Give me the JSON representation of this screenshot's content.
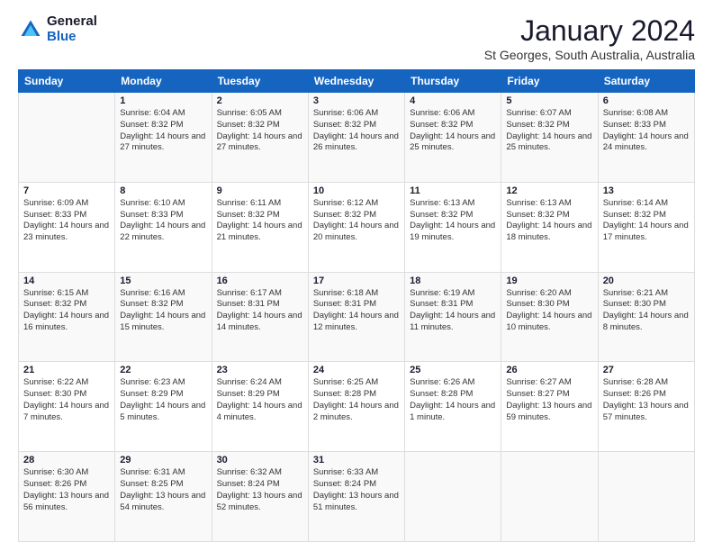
{
  "logo": {
    "general": "General",
    "blue": "Blue"
  },
  "header": {
    "title": "January 2024",
    "subtitle": "St Georges, South Australia, Australia"
  },
  "weekdays": [
    "Sunday",
    "Monday",
    "Tuesday",
    "Wednesday",
    "Thursday",
    "Friday",
    "Saturday"
  ],
  "weeks": [
    [
      {
        "day": "",
        "sunrise": "",
        "sunset": "",
        "daylight": ""
      },
      {
        "day": "1",
        "sunrise": "Sunrise: 6:04 AM",
        "sunset": "Sunset: 8:32 PM",
        "daylight": "Daylight: 14 hours and 27 minutes."
      },
      {
        "day": "2",
        "sunrise": "Sunrise: 6:05 AM",
        "sunset": "Sunset: 8:32 PM",
        "daylight": "Daylight: 14 hours and 27 minutes."
      },
      {
        "day": "3",
        "sunrise": "Sunrise: 6:06 AM",
        "sunset": "Sunset: 8:32 PM",
        "daylight": "Daylight: 14 hours and 26 minutes."
      },
      {
        "day": "4",
        "sunrise": "Sunrise: 6:06 AM",
        "sunset": "Sunset: 8:32 PM",
        "daylight": "Daylight: 14 hours and 25 minutes."
      },
      {
        "day": "5",
        "sunrise": "Sunrise: 6:07 AM",
        "sunset": "Sunset: 8:32 PM",
        "daylight": "Daylight: 14 hours and 25 minutes."
      },
      {
        "day": "6",
        "sunrise": "Sunrise: 6:08 AM",
        "sunset": "Sunset: 8:33 PM",
        "daylight": "Daylight: 14 hours and 24 minutes."
      }
    ],
    [
      {
        "day": "7",
        "sunrise": "Sunrise: 6:09 AM",
        "sunset": "Sunset: 8:33 PM",
        "daylight": "Daylight: 14 hours and 23 minutes."
      },
      {
        "day": "8",
        "sunrise": "Sunrise: 6:10 AM",
        "sunset": "Sunset: 8:33 PM",
        "daylight": "Daylight: 14 hours and 22 minutes."
      },
      {
        "day": "9",
        "sunrise": "Sunrise: 6:11 AM",
        "sunset": "Sunset: 8:32 PM",
        "daylight": "Daylight: 14 hours and 21 minutes."
      },
      {
        "day": "10",
        "sunrise": "Sunrise: 6:12 AM",
        "sunset": "Sunset: 8:32 PM",
        "daylight": "Daylight: 14 hours and 20 minutes."
      },
      {
        "day": "11",
        "sunrise": "Sunrise: 6:13 AM",
        "sunset": "Sunset: 8:32 PM",
        "daylight": "Daylight: 14 hours and 19 minutes."
      },
      {
        "day": "12",
        "sunrise": "Sunrise: 6:13 AM",
        "sunset": "Sunset: 8:32 PM",
        "daylight": "Daylight: 14 hours and 18 minutes."
      },
      {
        "day": "13",
        "sunrise": "Sunrise: 6:14 AM",
        "sunset": "Sunset: 8:32 PM",
        "daylight": "Daylight: 14 hours and 17 minutes."
      }
    ],
    [
      {
        "day": "14",
        "sunrise": "Sunrise: 6:15 AM",
        "sunset": "Sunset: 8:32 PM",
        "daylight": "Daylight: 14 hours and 16 minutes."
      },
      {
        "day": "15",
        "sunrise": "Sunrise: 6:16 AM",
        "sunset": "Sunset: 8:32 PM",
        "daylight": "Daylight: 14 hours and 15 minutes."
      },
      {
        "day": "16",
        "sunrise": "Sunrise: 6:17 AM",
        "sunset": "Sunset: 8:31 PM",
        "daylight": "Daylight: 14 hours and 14 minutes."
      },
      {
        "day": "17",
        "sunrise": "Sunrise: 6:18 AM",
        "sunset": "Sunset: 8:31 PM",
        "daylight": "Daylight: 14 hours and 12 minutes."
      },
      {
        "day": "18",
        "sunrise": "Sunrise: 6:19 AM",
        "sunset": "Sunset: 8:31 PM",
        "daylight": "Daylight: 14 hours and 11 minutes."
      },
      {
        "day": "19",
        "sunrise": "Sunrise: 6:20 AM",
        "sunset": "Sunset: 8:30 PM",
        "daylight": "Daylight: 14 hours and 10 minutes."
      },
      {
        "day": "20",
        "sunrise": "Sunrise: 6:21 AM",
        "sunset": "Sunset: 8:30 PM",
        "daylight": "Daylight: 14 hours and 8 minutes."
      }
    ],
    [
      {
        "day": "21",
        "sunrise": "Sunrise: 6:22 AM",
        "sunset": "Sunset: 8:30 PM",
        "daylight": "Daylight: 14 hours and 7 minutes."
      },
      {
        "day": "22",
        "sunrise": "Sunrise: 6:23 AM",
        "sunset": "Sunset: 8:29 PM",
        "daylight": "Daylight: 14 hours and 5 minutes."
      },
      {
        "day": "23",
        "sunrise": "Sunrise: 6:24 AM",
        "sunset": "Sunset: 8:29 PM",
        "daylight": "Daylight: 14 hours and 4 minutes."
      },
      {
        "day": "24",
        "sunrise": "Sunrise: 6:25 AM",
        "sunset": "Sunset: 8:28 PM",
        "daylight": "Daylight: 14 hours and 2 minutes."
      },
      {
        "day": "25",
        "sunrise": "Sunrise: 6:26 AM",
        "sunset": "Sunset: 8:28 PM",
        "daylight": "Daylight: 14 hours and 1 minute."
      },
      {
        "day": "26",
        "sunrise": "Sunrise: 6:27 AM",
        "sunset": "Sunset: 8:27 PM",
        "daylight": "Daylight: 13 hours and 59 minutes."
      },
      {
        "day": "27",
        "sunrise": "Sunrise: 6:28 AM",
        "sunset": "Sunset: 8:26 PM",
        "daylight": "Daylight: 13 hours and 57 minutes."
      }
    ],
    [
      {
        "day": "28",
        "sunrise": "Sunrise: 6:30 AM",
        "sunset": "Sunset: 8:26 PM",
        "daylight": "Daylight: 13 hours and 56 minutes."
      },
      {
        "day": "29",
        "sunrise": "Sunrise: 6:31 AM",
        "sunset": "Sunset: 8:25 PM",
        "daylight": "Daylight: 13 hours and 54 minutes."
      },
      {
        "day": "30",
        "sunrise": "Sunrise: 6:32 AM",
        "sunset": "Sunset: 8:24 PM",
        "daylight": "Daylight: 13 hours and 52 minutes."
      },
      {
        "day": "31",
        "sunrise": "Sunrise: 6:33 AM",
        "sunset": "Sunset: 8:24 PM",
        "daylight": "Daylight: 13 hours and 51 minutes."
      },
      {
        "day": "",
        "sunrise": "",
        "sunset": "",
        "daylight": ""
      },
      {
        "day": "",
        "sunrise": "",
        "sunset": "",
        "daylight": ""
      },
      {
        "day": "",
        "sunrise": "",
        "sunset": "",
        "daylight": ""
      }
    ]
  ]
}
